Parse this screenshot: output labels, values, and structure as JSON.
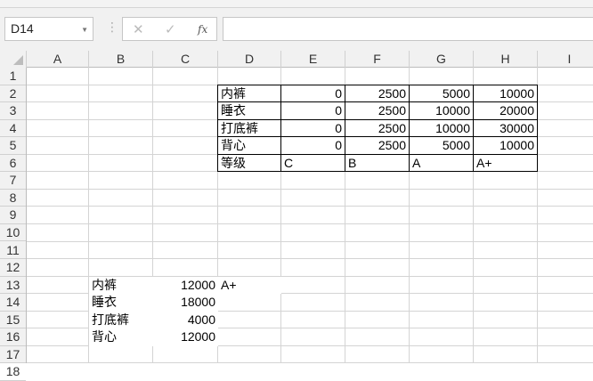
{
  "formula_bar": {
    "name_box": "D14",
    "cancel_icon": "✕",
    "enter_icon": "✓",
    "fx_label": "fx",
    "formula": ""
  },
  "columns": [
    "A",
    "B",
    "C",
    "D",
    "E",
    "F",
    "G",
    "H",
    "I"
  ],
  "rows": [
    "1",
    "2",
    "3",
    "4",
    "5",
    "6",
    "7",
    "8",
    "9",
    "10",
    "11",
    "12",
    "13",
    "14",
    "15",
    "16",
    "17",
    "18"
  ],
  "table": {
    "rows": [
      {
        "row": 2,
        "cells": [
          "内裤",
          "0",
          "2500",
          "5000",
          "10000"
        ]
      },
      {
        "row": 3,
        "cells": [
          "睡衣",
          "0",
          "2500",
          "10000",
          "20000"
        ]
      },
      {
        "row": 4,
        "cells": [
          "打底裤",
          "0",
          "2500",
          "10000",
          "30000"
        ]
      },
      {
        "row": 5,
        "cells": [
          "背心",
          "0",
          "2500",
          "5000",
          "10000"
        ]
      },
      {
        "row": 6,
        "cells": [
          "等级",
          "C",
          "B",
          "A",
          "A+"
        ]
      }
    ]
  },
  "list": [
    {
      "row": 13,
      "name": "内裤",
      "value": "12000",
      "grade": "A+"
    },
    {
      "row": 14,
      "name": "睡衣",
      "value": "18000",
      "grade": ""
    },
    {
      "row": 15,
      "name": "打底裤",
      "value": "4000",
      "grade": ""
    },
    {
      "row": 16,
      "name": "背心",
      "value": "12000",
      "grade": ""
    }
  ]
}
